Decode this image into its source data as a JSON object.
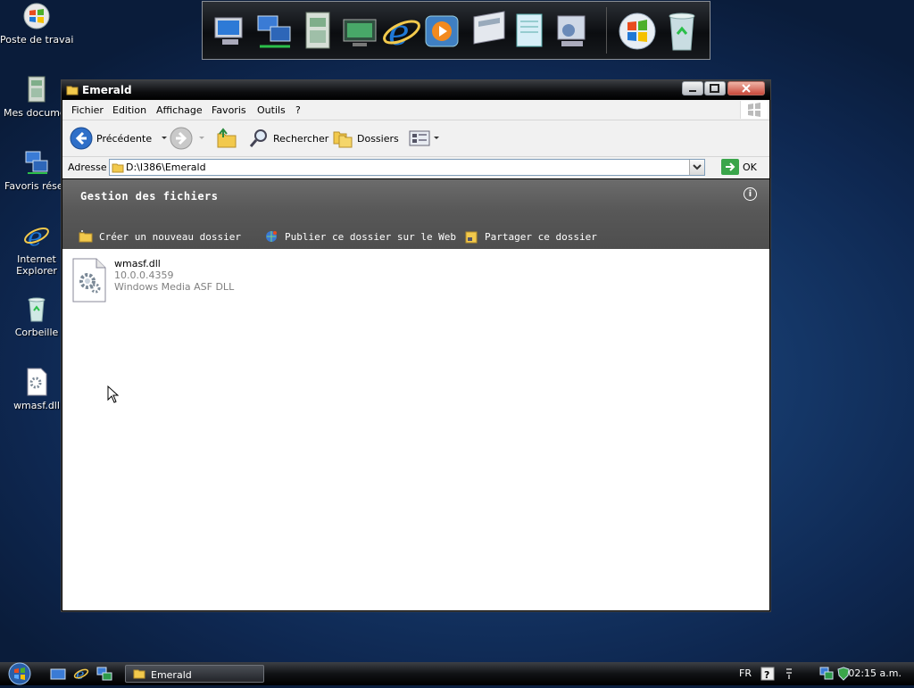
{
  "desktop": {
    "icons": [
      {
        "label": "Poste de travail",
        "icon": "windows-logo-icon"
      },
      {
        "label": "Mes documents",
        "icon": "documents-icon"
      },
      {
        "label": "Favoris réseau",
        "icon": "network-icon"
      },
      {
        "label": "Internet Explorer",
        "icon": "internet-explorer-icon"
      },
      {
        "label": "Corbeille",
        "icon": "recycle-bin-icon"
      },
      {
        "label": "wmasf.dll",
        "icon": "dll-file-icon"
      }
    ]
  },
  "dock": {
    "items": [
      "computer-icon",
      "network-icon",
      "documents-icon",
      "media-center-icon",
      "internet-explorer-icon",
      "media-player-icon",
      "calculator-icon",
      "notepad-icon",
      "control-panel-icon",
      "windows-logo-icon",
      "recycle-bin-icon"
    ]
  },
  "window": {
    "title": "Emerald",
    "menu": [
      "Fichier",
      "Edition",
      "Affichage",
      "Favoris",
      "Outils",
      "?"
    ],
    "toolbar": {
      "back_label": "Précédente",
      "search_label": "Rechercher",
      "folders_label": "Dossiers"
    },
    "address": {
      "label": "Adresse",
      "value": "D:\\I386\\Emerald",
      "go_label": "OK"
    },
    "tasks": {
      "header": "Gestion des fichiers",
      "info_glyph": "i",
      "items": [
        "Créer un nouveau dossier",
        "Publier ce dossier sur le Web",
        "Partager ce dossier"
      ]
    },
    "file": {
      "name": "wmasf.dll",
      "version": "10.0.0.4359",
      "description": "Windows Media ASF DLL"
    }
  },
  "taskbar": {
    "task_button": "Emerald",
    "language": "FR",
    "clock": "02:15 a.m."
  },
  "colors": {
    "desktop": "#163a6c",
    "window_frame": "#000000",
    "task_pane": "#5c5c5c",
    "ie_blue": "#1f78d6",
    "folder_yellow": "#f2c94c"
  }
}
